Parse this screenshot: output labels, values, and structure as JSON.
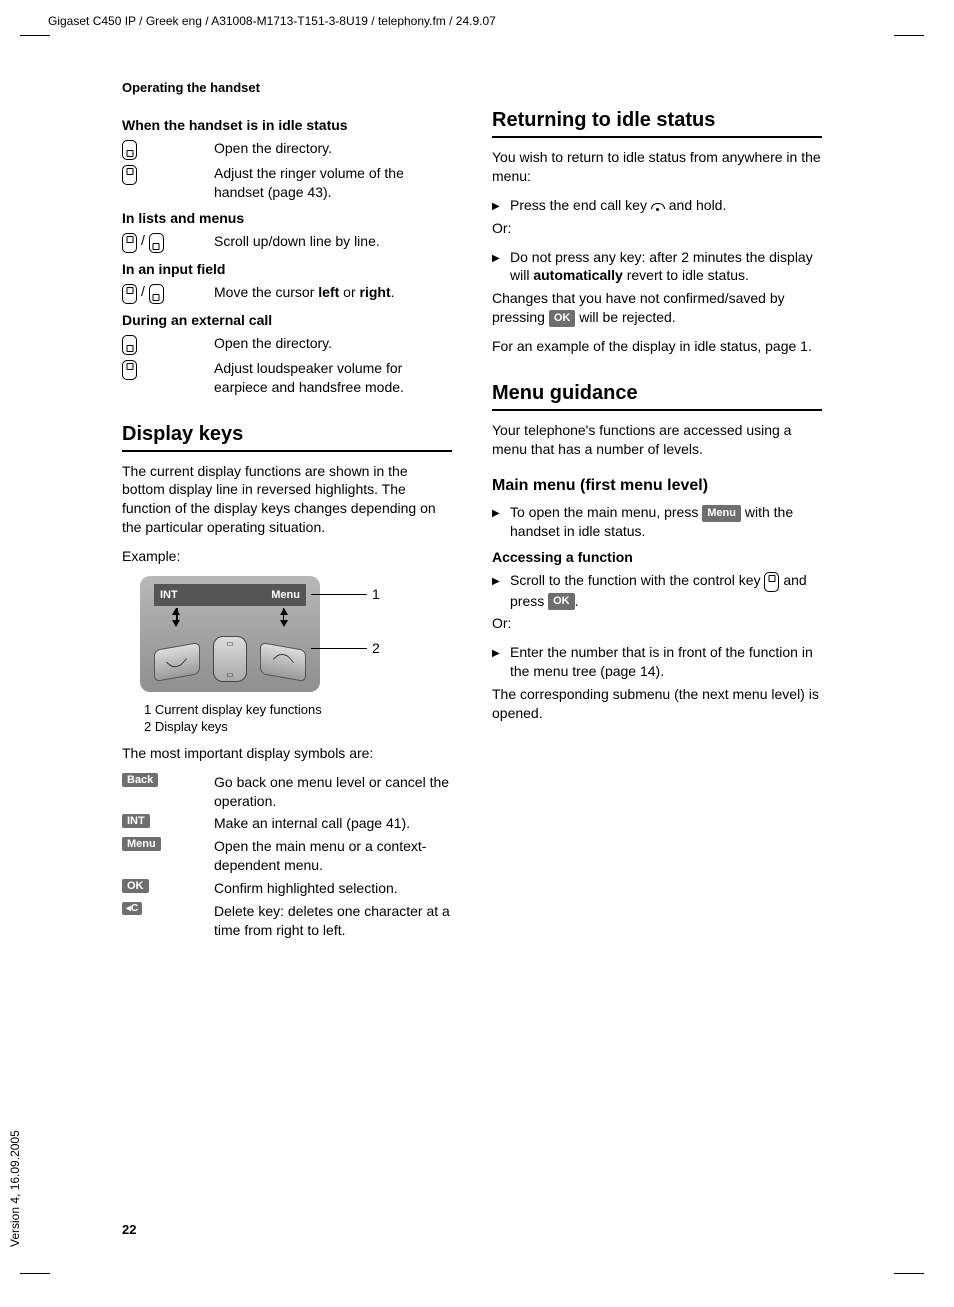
{
  "header_path": "Gigaset C450 IP / Greek eng / A31008-M1713-T151-3-8U19 / telephony.fm / 24.9.07",
  "version": "Version 4, 16.09.2005",
  "running_head": "Operating the handset",
  "page_number": "22",
  "left": {
    "sub1": "When the handset is in idle status",
    "r1": "Open the directory.",
    "r2": "Adjust the ringer volume of the handset (page 43).",
    "sub2": "In lists and menus",
    "r3": "Scroll up/down line by line.",
    "sub3": "In an input field",
    "r4a": "Move the cursor ",
    "r4b": "left",
    "r4c": " or ",
    "r4d": "right",
    "r4e": ".",
    "sub4": "During an external call",
    "r5": "Open the directory.",
    "r6": "Adjust loudspeaker volume for earpiece and handsfree mode.",
    "h2": "Display keys",
    "p1": "The current display functions are shown in the bottom display line in reversed highlights. The function of the display keys changes depending on the particular operating situation.",
    "example": "Example:",
    "fig_int": "INT",
    "fig_menu": "Menu",
    "cap1": "1 Current display key functions",
    "cap2": "2 Display keys",
    "p2": "The most important display symbols are:",
    "sym": {
      "back": "Back",
      "back_txt": "Go back one menu level or cancel the operation.",
      "int": "INT",
      "int_txt": "Make an internal call (page 41).",
      "menu": "Menu",
      "menu_txt": "Open the main menu or a context-dependent menu.",
      "ok": "OK",
      "ok_txt": "Confirm highlighted selection.",
      "c": "◂C",
      "c_txt": "Delete key: deletes one character at a time from right to left."
    }
  },
  "right": {
    "h2a": "Returning to idle status",
    "p1": "You wish to return to idle status from anywhere in the menu:",
    "b1a": "Press the end call key ",
    "b1b": " and hold.",
    "or": "Or:",
    "b2a": "Do not press any key: after 2 minutes the display will ",
    "b2b": "automatically",
    "b2c": " revert to idle status.",
    "p2a": "Changes that you have not confirmed/saved by pressing ",
    "ok": "OK",
    "p2b": " will be rejected.",
    "p3": "For an example of the display in idle status, page 1.",
    "h2b": "Menu guidance",
    "p4": "Your telephone's functions are accessed using a menu that has a number of levels.",
    "h3": "Main menu (first menu level)",
    "b3a": "To open the main menu, press ",
    "menu": "Menu",
    "b3b": " with the handset in idle status.",
    "sub5": "Accessing a function",
    "b4a": "Scroll to the function with the control key ",
    "b4b": " and press ",
    "b4c": ".",
    "b5": "Enter the number that is in front of the function in the menu tree (page 14).",
    "p5": "The corresponding submenu (the next menu level) is opened."
  }
}
